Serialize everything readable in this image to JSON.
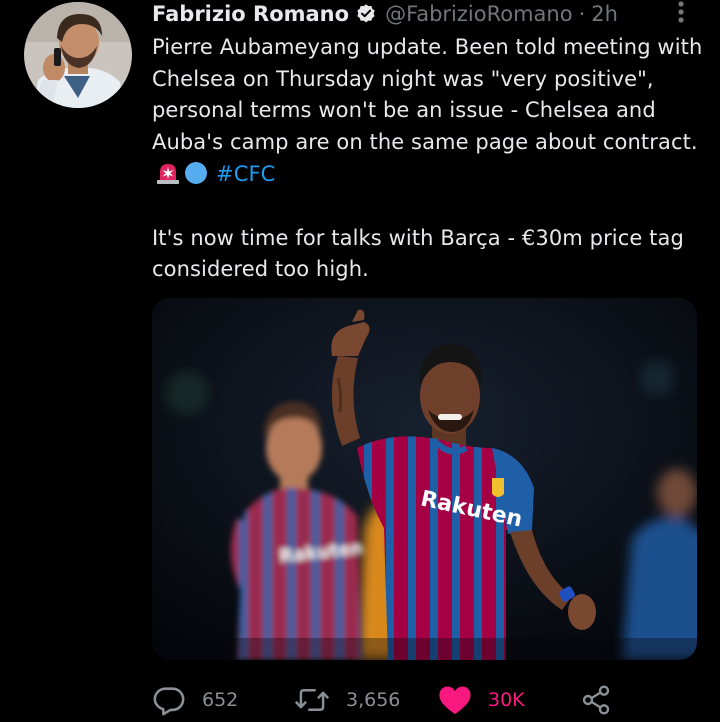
{
  "tweet": {
    "author_name": "Fabrizio Romano",
    "handle": "@FabrizioRomano",
    "separator": "·",
    "time": "2h",
    "paragraph1": "Pierre Aubameyang update. Been told meeting with Chelsea on Thursday night was \"very positive\", personal terms won't be an issue - Chelsea and Auba's camp are on the same page about contract.",
    "hashtag": "#CFC",
    "paragraph2": "It's now time for talks with Barça - €30m price tag considered too high.",
    "media_shirt_text": "Rakuten"
  },
  "actions": {
    "replies": "652",
    "retweets": "3,656",
    "likes": "30K"
  },
  "icons": {
    "verified": "verified-badge-icon",
    "more": "more-dots-icon",
    "siren": "siren-emoji-icon",
    "blue_circle": "blue-circle-emoji-icon",
    "reply": "reply-icon",
    "retweet": "retweet-icon",
    "like": "heart-icon",
    "share": "share-icon"
  },
  "colors": {
    "background": "#000000",
    "text": "#e7e9ea",
    "muted": "#71767b",
    "link": "#1d9bf0",
    "like": "#f91880",
    "shirt_red": "#a50044",
    "shirt_blue": "#1f5fa8"
  }
}
